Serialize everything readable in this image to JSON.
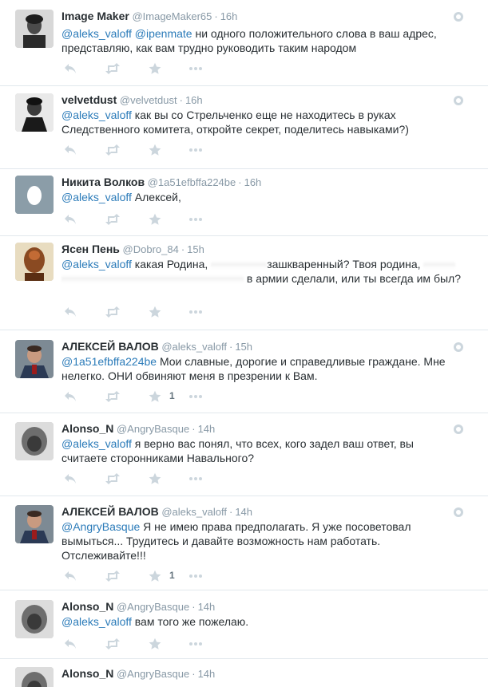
{
  "tweets": [
    {
      "name": "Image Maker",
      "handle": "@ImageMaker65",
      "time": "16h",
      "mentions": "@aleks_valoff @ipenmate",
      "text": " ни одного положительного слова в ваш адрес, представляю, как вам трудно руководить таким народом",
      "fav_count": ""
    },
    {
      "name": "velvetdust",
      "handle": "@velvetdust",
      "time": "16h",
      "mentions": "@aleks_valoff",
      "text": " как вы со Стрельченко еще не находитесь в руках Следственного комитета, откройте секрет, поделитесь навыками?)",
      "fav_count": ""
    },
    {
      "name": "Никита Волков",
      "handle": "@1a51efbffa224be",
      "time": "16h",
      "mentions": "@aleks_valoff",
      "text": " Алексей,",
      "fav_count": ""
    },
    {
      "name": "Ясен Пень",
      "handle": "@Dobro_84",
      "time": "15h",
      "mentions": "@aleks_valoff",
      "text_a": " какая Родина,",
      "text_b": "зашкваренный? Твоя родина,",
      "text_c": "в армии сделали, или ты всегда им был?",
      "fav_count": ""
    },
    {
      "name": "АЛЕКСЕЙ ВАЛОВ",
      "handle": "@aleks_valoff",
      "time": "15h",
      "mentions": "@1a51efbffa224be",
      "text": " Мои славные, дорогие и справедливые граждане. Мне нелегко. ОНИ обвиняют меня в презрении к Вам.",
      "fav_count": "1"
    },
    {
      "name": "Alonso_N",
      "handle": "@AngryBasque",
      "time": "14h",
      "mentions": "@aleks_valoff",
      "text": " я верно вас понял, что всех, кого задел ваш ответ, вы считаете сторонниками Навального?",
      "fav_count": ""
    },
    {
      "name": "АЛЕКСЕЙ ВАЛОВ",
      "handle": "@aleks_valoff",
      "time": "14h",
      "mentions": "@AngryBasque",
      "text": " Я не имею права предполагать. Я уже посоветовал вымыться... Трудитесь и давайте возможность нам работать. Отслеживайте!!!",
      "fav_count": "1"
    },
    {
      "name": "Alonso_N",
      "handle": "@AngryBasque",
      "time": "14h",
      "mentions": "@aleks_valoff",
      "text": " вам того же пожелаю.",
      "fav_count": ""
    },
    {
      "name": "Alonso_N",
      "handle": "@AngryBasque",
      "time": "14h",
      "mentions": "",
      "text": "",
      "fav_count": ""
    }
  ],
  "separator": "·",
  "icons": {
    "reply": "reply-icon",
    "retweet": "retweet-icon",
    "favorite": "star-icon",
    "more": "more-icon",
    "collapse": "collapse-icon"
  },
  "colors": {
    "mention": "#2b7bb9",
    "name": "#292f33",
    "meta": "#8899a6",
    "action_icon": "#ccd6dd",
    "divider": "#e1e8ed"
  }
}
